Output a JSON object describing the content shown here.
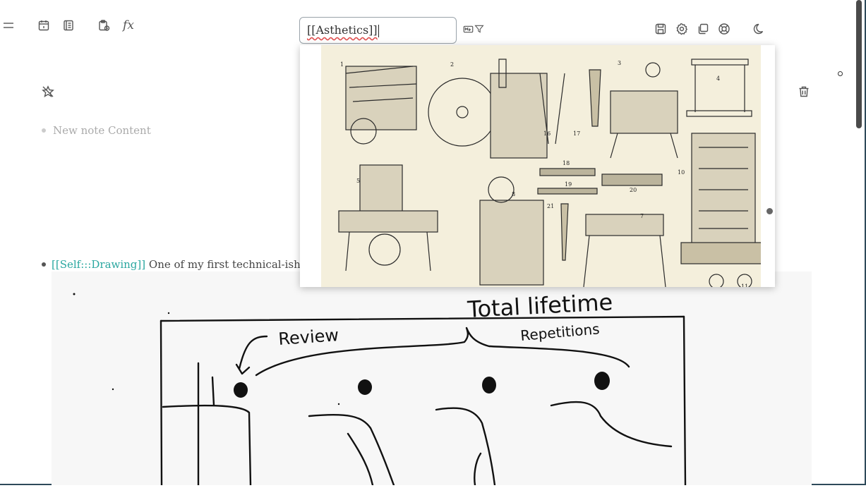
{
  "toolbar": {
    "left_icons": [
      "menu-icon",
      "calendar-icon",
      "journal-icon",
      "clipboard-icon",
      "function-icon"
    ],
    "function_label": "fx",
    "right_icons": [
      "save-icon",
      "gear-icon",
      "copy-icon",
      "help-icon",
      "moon-icon"
    ],
    "filter_icons": [
      "markdown-icon",
      "filter-icon"
    ]
  },
  "search": {
    "value": "[[Asthetics]]"
  },
  "note": {
    "placeholder": "New note Content",
    "block": {
      "reference": "[[Self:::Drawing]]",
      "text": "One of my first technical-ish drawi"
    }
  },
  "drawing": {
    "labels": [
      "Total lifetime",
      "Review",
      "Repetitions"
    ]
  },
  "popup_plate": {
    "figure_numbers": [
      "1",
      "2",
      "3",
      "4",
      "5",
      "7",
      "8",
      "10",
      "11",
      "16",
      "17",
      "18",
      "19",
      "20",
      "21"
    ]
  },
  "background_faint": [
    "Th",
    "Re",
    "ns",
    "u"
  ],
  "colors": {
    "reference": "#2aa7a0",
    "frame": "#2e4a5a",
    "plate": "#f4efdc"
  }
}
